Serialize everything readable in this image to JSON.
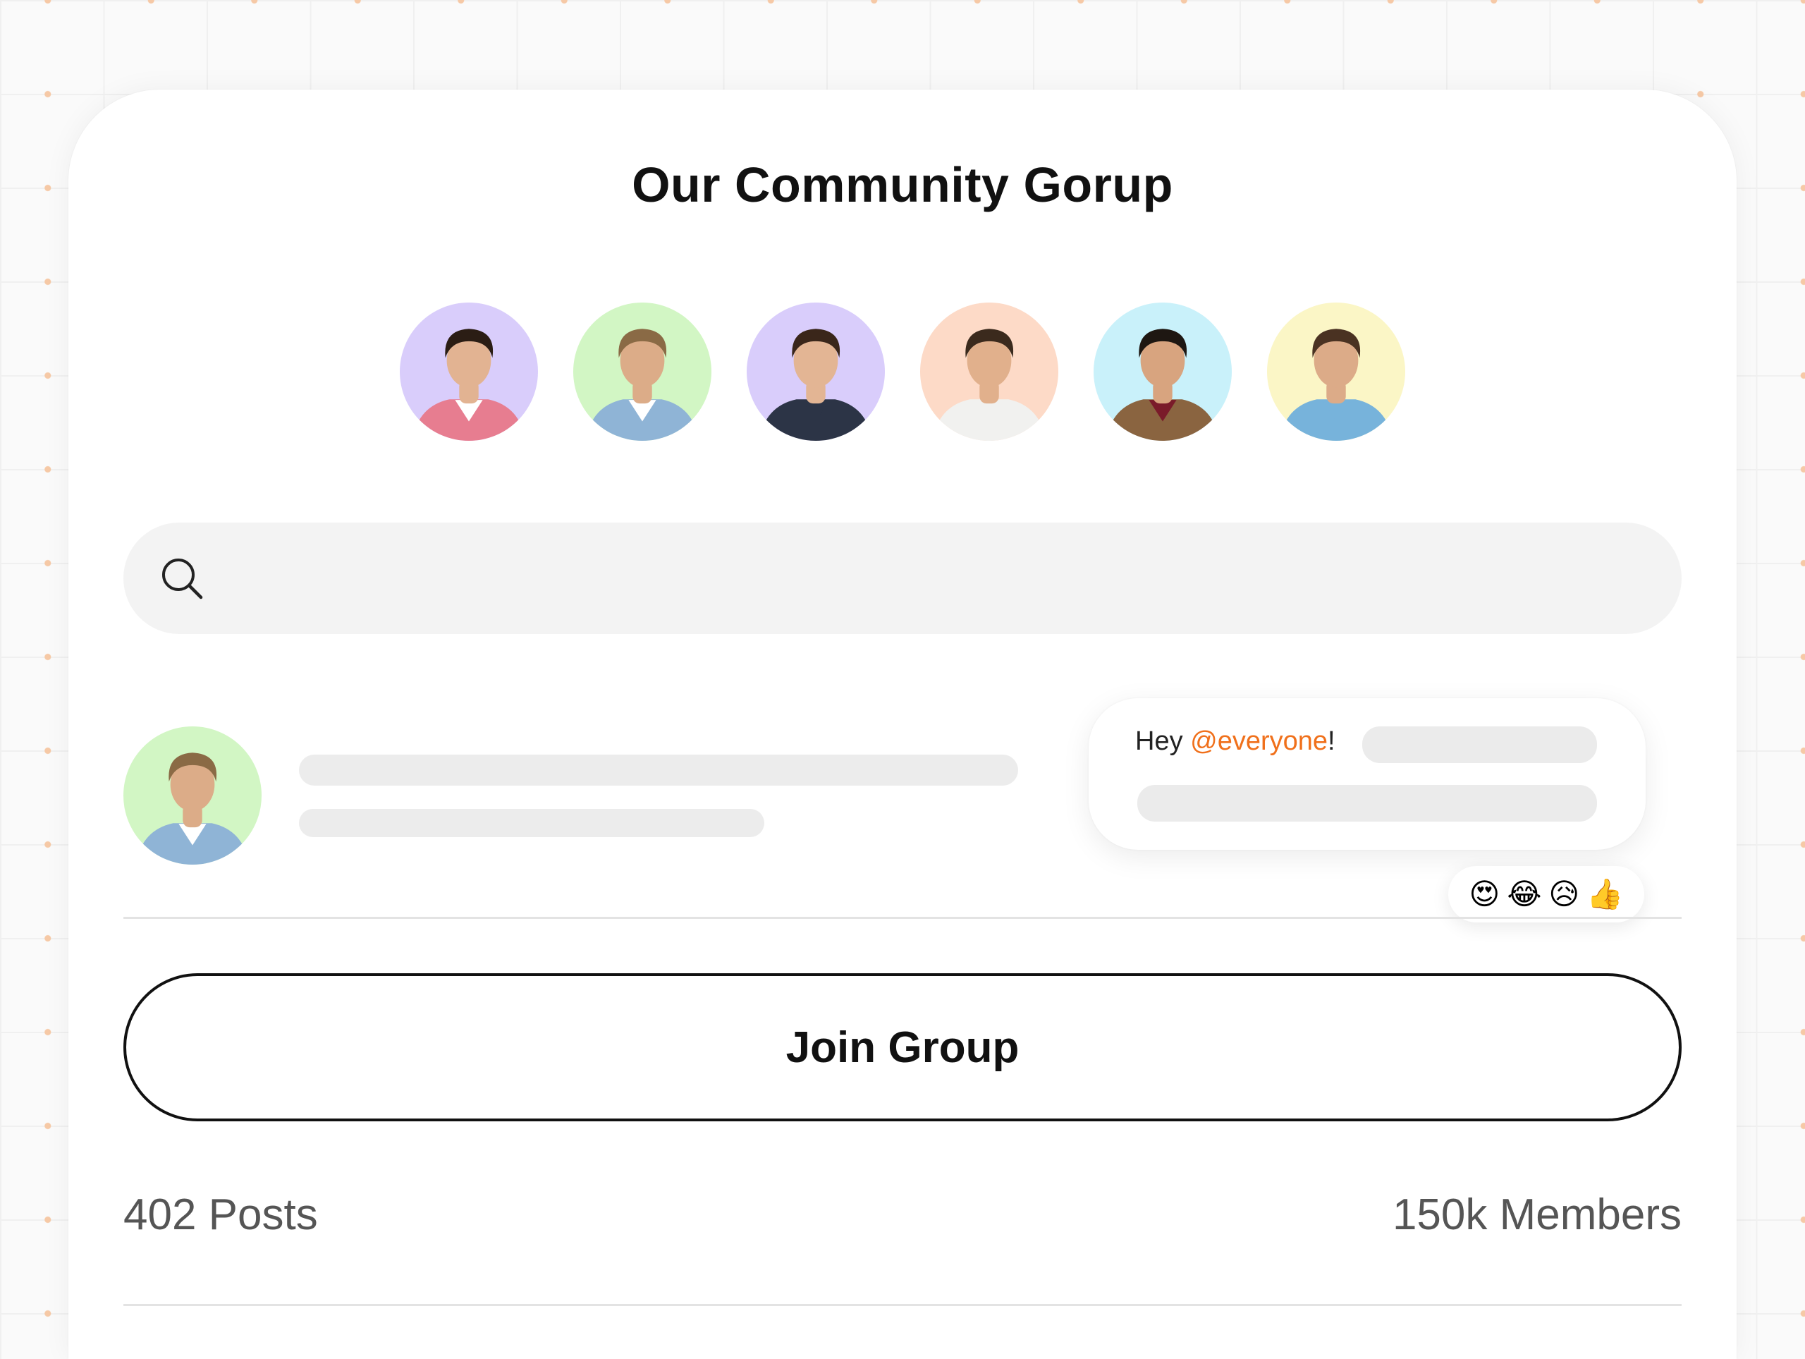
{
  "group": {
    "title": "Our Community Gorup"
  },
  "members": [
    {
      "name": "member-1",
      "bg": "#d9cdfb",
      "skin": "#e2b392",
      "hair": "#2b1d14",
      "shirt": "#e77d90",
      "inner": "#ffffff"
    },
    {
      "name": "member-2",
      "bg": "#d2f6c4",
      "skin": "#dcac88",
      "hair": "#8a6a45",
      "shirt": "#8fb4d6",
      "inner": "#ffffff"
    },
    {
      "name": "member-3",
      "bg": "#d9cdfb",
      "skin": "#e3b594",
      "hair": "#3a261a",
      "shirt": "#2c3446",
      "inner": "#2c3446"
    },
    {
      "name": "member-4",
      "bg": "#fddac7",
      "skin": "#e1b08c",
      "hair": "#3b2a1d",
      "shirt": "#f1f1ef",
      "inner": "#f1f1ef"
    },
    {
      "name": "member-5",
      "bg": "#c9f1fa",
      "skin": "#d8a47f",
      "hair": "#1e1712",
      "shirt": "#8a6440",
      "inner": "#7a1b2a"
    },
    {
      "name": "member-6",
      "bg": "#fbf6c6",
      "skin": "#dcab88",
      "hair": "#4a3222",
      "shirt": "#77b3db",
      "inner": "#77b3db"
    }
  ],
  "search": {
    "placeholder": "",
    "value": ""
  },
  "post": {
    "author": {
      "bg": "#d2f6c4",
      "skin": "#dcac88",
      "hair": "#8a6a45",
      "shirt": "#8fb4d6",
      "inner": "#ffffff"
    }
  },
  "chat": {
    "greeting": "Hey ",
    "mention": "@everyone",
    "punct": "!"
  },
  "reactions": [
    "😍",
    "😂",
    "😥",
    "👍"
  ],
  "actions": {
    "join_label": "Join Group"
  },
  "stats": {
    "posts": "402 Posts",
    "members": "150k Members"
  },
  "colors": {
    "accent": "#f0701b",
    "grid_dot": "#f6c9a6"
  }
}
